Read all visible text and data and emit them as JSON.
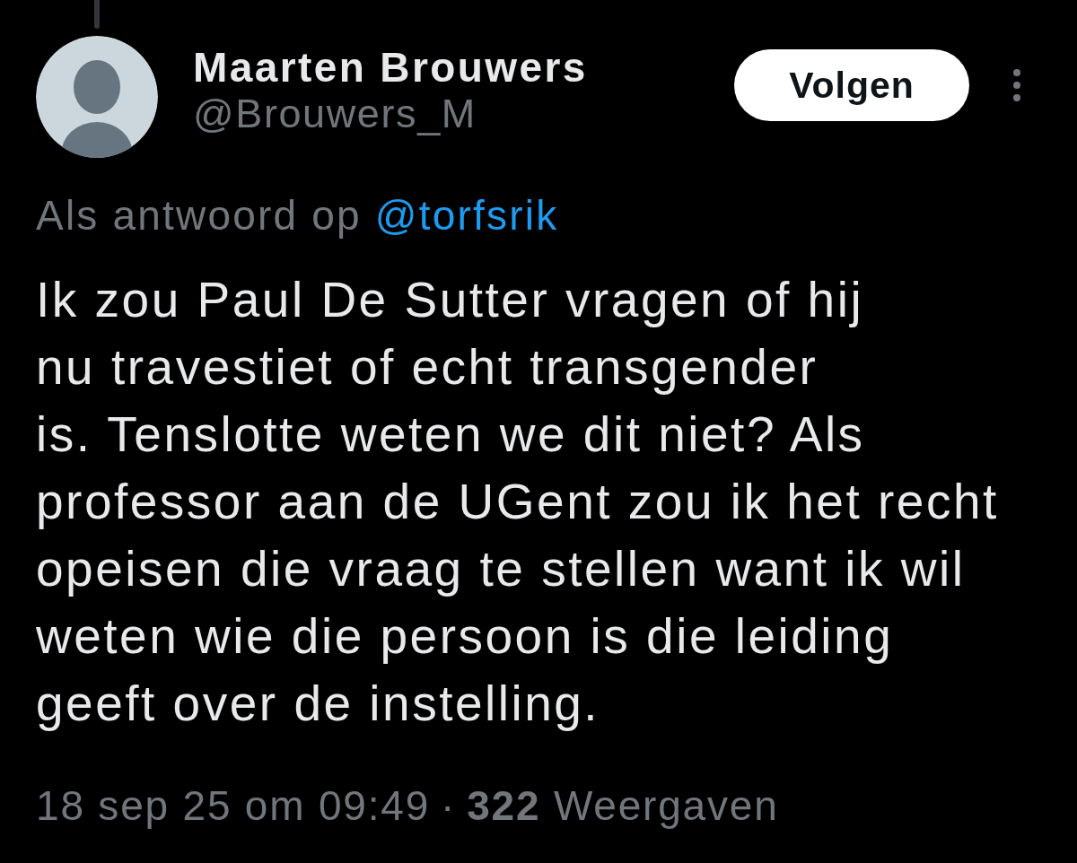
{
  "author": {
    "name": "Maarten Brouwers",
    "handle": "@Brouwers_M"
  },
  "follow_button": {
    "label": "Volgen"
  },
  "reply_context": {
    "prefix": "Als antwoord op",
    "mention": "@torfsrik"
  },
  "text": "Ik zou Paul De Sutter vragen of hij\nnu travestiet of echt transgender\nis. Tenslotte weten we dit niet? Als\nprofessor aan de UGent zou ik het recht\nopeisen die vraag te stellen want ik wil\nweten wie die persoon is die leiding\ngeeft over de instelling.",
  "meta": {
    "timestamp": "18 sep 25 om 09:49",
    "separator": "·",
    "views": "**322** Weergaven"
  }
}
